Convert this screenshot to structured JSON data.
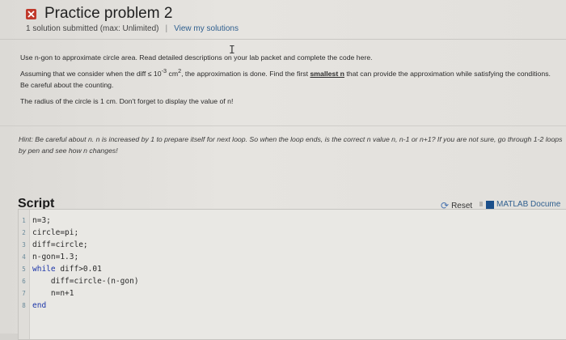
{
  "header": {
    "title": "Practice problem 2",
    "submissions": "1 solution submitted (max: Unlimited)",
    "separator": "|",
    "view_solutions": "View my solutions"
  },
  "problem": {
    "line1": "Use n-gon to approximate circle area. Read detailed descriptions on your lab packet and complete the code here.",
    "line2_before": "Assuming that we consider when the diff ≤ 10",
    "line2_exp1": "-3",
    "line2_mid": " cm",
    "line2_exp2": "2",
    "line2_after": ", the approximation is done. Find the first ",
    "line2_bold": "smallest n",
    "line2_end": " that can provide the approximation while satisfying the conditions. Be careful about the counting.",
    "line3": "The radius of the circle is 1 cm. Don't forget to display the value of n!"
  },
  "hint": "Hint: Be careful about n. n is increased by 1 to prepare itself for next loop. So when the loop ends, is the correct n value n, n-1 or n+1? If you are not sure, go through 1-2 loops by pen and see how n changes!",
  "script": {
    "title": "Script",
    "reset_label": "Reset",
    "docs_label": "MATLAB Docume",
    "lines": [
      {
        "num": "1",
        "pre": "n=3;",
        "kw": "",
        "post": ""
      },
      {
        "num": "2",
        "pre": "circle=pi;",
        "kw": "",
        "post": ""
      },
      {
        "num": "3",
        "pre": "diff=circle;",
        "kw": "",
        "post": ""
      },
      {
        "num": "4",
        "pre": "n-gon=1.3;",
        "kw": "",
        "post": ""
      },
      {
        "num": "5",
        "pre": "",
        "kw": "while",
        "post": " diff>0.01"
      },
      {
        "num": "6",
        "pre": "    diff=circle-(n-gon)",
        "kw": "",
        "post": ""
      },
      {
        "num": "7",
        "pre": "    n=n+1",
        "kw": "",
        "post": ""
      },
      {
        "num": "8",
        "pre": "",
        "kw": "end",
        "post": ""
      }
    ]
  },
  "colors": {
    "close_icon": "#c0392b",
    "link": "#2f5f8f",
    "keyword": "#1c35a8"
  }
}
